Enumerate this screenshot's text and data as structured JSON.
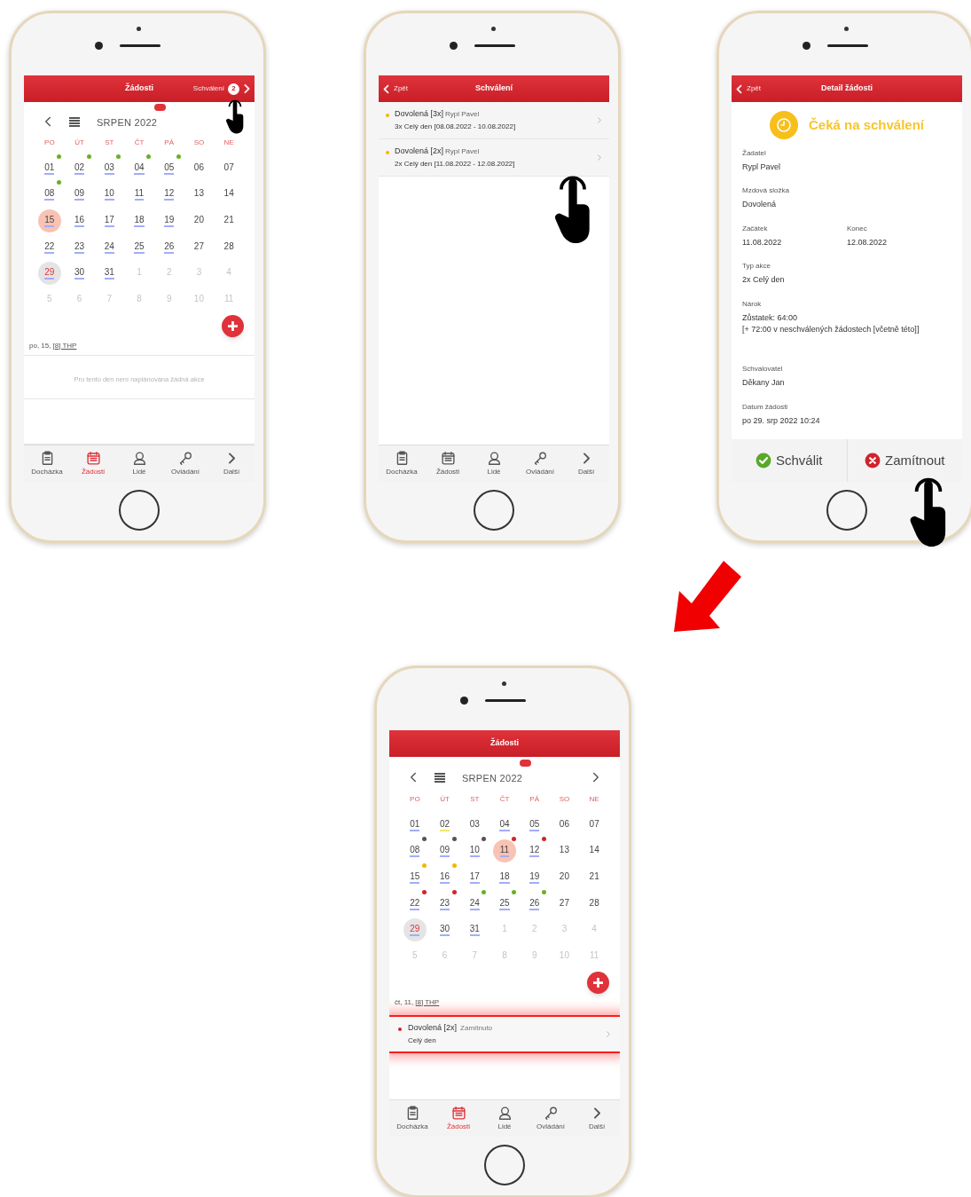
{
  "phones": [
    {
      "kind": "calendar",
      "pointer": true,
      "header": {
        "title": "Žádosti",
        "action": "Schválení",
        "badge": "2"
      },
      "calendar": {
        "month": "SRPEN 2022",
        "next_arrow": false,
        "weekdays": [
          "PO",
          "ÚT",
          "ST",
          "ČT",
          "PÁ",
          "SO",
          "NE"
        ],
        "days": [
          {
            "label": "01",
            "kind": "work",
            "selected": false,
            "today": false,
            "color": "#6ab023"
          },
          {
            "label": "02",
            "kind": "work",
            "selected": false,
            "today": false,
            "color": "#6ab023"
          },
          {
            "label": "03",
            "kind": "work",
            "selected": false,
            "today": false,
            "color": "#6ab023"
          },
          {
            "label": "04",
            "kind": "work",
            "selected": false,
            "today": false,
            "color": "#6ab023"
          },
          {
            "label": "05",
            "kind": "work",
            "selected": false,
            "today": false,
            "color": "#6ab023"
          },
          {
            "label": "06",
            "kind": "plain",
            "selected": false,
            "today": false
          },
          {
            "label": "07",
            "kind": "plain",
            "selected": false,
            "today": false
          },
          {
            "label": "08",
            "kind": "work",
            "selected": false,
            "today": false,
            "color": "#6ab023"
          },
          {
            "label": "09",
            "kind": "work",
            "selected": false,
            "today": false
          },
          {
            "label": "10",
            "kind": "work",
            "selected": false,
            "today": false
          },
          {
            "label": "11",
            "kind": "work",
            "selected": false,
            "today": false
          },
          {
            "label": "12",
            "kind": "work",
            "selected": false,
            "today": false
          },
          {
            "label": "13",
            "kind": "plain",
            "selected": false,
            "today": false
          },
          {
            "label": "14",
            "kind": "plain",
            "selected": false,
            "today": false
          },
          {
            "label": "15",
            "kind": "work",
            "selected": true,
            "today": false
          },
          {
            "label": "16",
            "kind": "work",
            "selected": false,
            "today": false
          },
          {
            "label": "17",
            "kind": "work",
            "selected": false,
            "today": false
          },
          {
            "label": "18",
            "kind": "work",
            "selected": false,
            "today": false
          },
          {
            "label": "19",
            "kind": "work",
            "selected": false,
            "today": false
          },
          {
            "label": "20",
            "kind": "plain",
            "selected": false,
            "today": false
          },
          {
            "label": "21",
            "kind": "plain",
            "selected": false,
            "today": false
          },
          {
            "label": "22",
            "kind": "work",
            "selected": false,
            "today": false
          },
          {
            "label": "23",
            "kind": "work",
            "selected": false,
            "today": false
          },
          {
            "label": "24",
            "kind": "work",
            "selected": false,
            "today": false
          },
          {
            "label": "25",
            "kind": "work",
            "selected": false,
            "today": false
          },
          {
            "label": "26",
            "kind": "work",
            "selected": false,
            "today": false
          },
          {
            "label": "27",
            "kind": "plain",
            "selected": false,
            "today": false
          },
          {
            "label": "28",
            "kind": "plain",
            "selected": false,
            "today": false
          },
          {
            "label": "29",
            "kind": "work",
            "selected": false,
            "today": true
          },
          {
            "label": "30",
            "kind": "work",
            "selected": false,
            "today": false
          },
          {
            "label": "31",
            "kind": "work",
            "selected": false,
            "today": false
          },
          {
            "label": "1",
            "kind": "outside",
            "selected": false,
            "today": false
          },
          {
            "label": "2",
            "kind": "outside",
            "selected": false,
            "today": false
          },
          {
            "label": "3",
            "kind": "outside",
            "selected": false,
            "today": false
          },
          {
            "label": "4",
            "kind": "outside",
            "selected": false,
            "today": false
          },
          {
            "label": "5",
            "kind": "outside",
            "selected": false,
            "today": false
          },
          {
            "label": "6",
            "kind": "outside",
            "selected": false,
            "today": false
          },
          {
            "label": "7",
            "kind": "outside",
            "selected": false,
            "today": false
          },
          {
            "label": "8",
            "kind": "outside",
            "selected": false,
            "today": false
          },
          {
            "label": "9",
            "kind": "outside",
            "selected": false,
            "today": false
          },
          {
            "label": "10",
            "kind": "outside",
            "selected": false,
            "today": false
          },
          {
            "label": "11",
            "kind": "outside",
            "selected": false,
            "today": false
          }
        ]
      },
      "day_label": {
        "date": "po, 15,",
        "shift": "[8] THP"
      },
      "empty_message": "Pro tento den není naplánována žádná akce",
      "tabs": [
        {
          "label": "Docházka",
          "kind": "clipboard",
          "selected": false
        },
        {
          "label": "Žádosti",
          "kind": "calendar",
          "selected": true
        },
        {
          "label": "Lidé",
          "kind": "person",
          "selected": false
        },
        {
          "label": "Ovládání",
          "kind": "key",
          "selected": false
        },
        {
          "label": "Další",
          "kind": "more",
          "selected": false
        }
      ]
    },
    {
      "kind": "list",
      "pointer": true,
      "header": {
        "back": "Zpět",
        "title": "Schválení"
      },
      "items": [
        {
          "title": "Dovolená [3x]",
          "person": "Rypl Pavel",
          "subtitle": "3x Celý den [08.08.2022 - 10.08.2022]",
          "color": "#f5b800"
        },
        {
          "title": "Dovolená [2x]",
          "person": "Rypl Pavel",
          "subtitle": "2x Celý den [11.08.2022 - 12.08.2022]",
          "color": "#f5b800"
        }
      ],
      "tabs": [
        {
          "label": "Docházka",
          "kind": "clipboard",
          "selected": false
        },
        {
          "label": "Žádosti",
          "kind": "calendar",
          "selected": false
        },
        {
          "label": "Lidé",
          "kind": "person",
          "selected": false
        },
        {
          "label": "Ovládání",
          "kind": "key",
          "selected": false
        },
        {
          "label": "Další",
          "kind": "more",
          "selected": false
        }
      ]
    },
    {
      "kind": "detail",
      "pointer": true,
      "header": {
        "back": "Zpět",
        "title": "Detail žádosti"
      },
      "status": "Čeká na schválení",
      "fields": [
        {
          "label": "Žadatel",
          "value": "Rypl Pavel",
          "kind": "full"
        },
        {
          "label": "Mzdová složka",
          "value": "Dovolená",
          "kind": "full"
        },
        {
          "label": "Začátek",
          "value": "11.08.2022",
          "kind": "half"
        },
        {
          "label": "Konec",
          "value": "12.08.2022",
          "kind": "half"
        },
        {
          "label": "Typ akce",
          "value": "2x Celý den",
          "kind": "full"
        },
        {
          "label": "Nárok",
          "value": "Zůstatek: 64:00\n[+ 72:00 v neschválených žádostech [včetně této]]",
          "kind": "tall"
        },
        {
          "label": "Schvalovatel",
          "value": "Děkany Jan",
          "kind": "full"
        },
        {
          "label": "Datum žádosti",
          "value": "po 29. srp 2022 10:24",
          "kind": "full"
        }
      ],
      "actions": [
        {
          "label": "Schválit",
          "kind": "approve"
        },
        {
          "label": "Zamítnout",
          "kind": "reject"
        }
      ]
    },
    {
      "kind": "calendar",
      "pointer": false,
      "header": {
        "title": "Žádosti"
      },
      "calendar": {
        "month": "SRPEN 2022",
        "next_arrow": true,
        "weekdays": [
          "PO",
          "ÚT",
          "ST",
          "ČT",
          "PÁ",
          "SO",
          "NE"
        ],
        "days": [
          {
            "label": "01",
            "kind": "work",
            "selected": false,
            "today": false
          },
          {
            "label": "02",
            "kind": "pending",
            "selected": false,
            "today": false
          },
          {
            "label": "03",
            "kind": "plain",
            "selected": false,
            "today": false
          },
          {
            "label": "04",
            "kind": "work",
            "selected": false,
            "today": false
          },
          {
            "label": "05",
            "kind": "work",
            "selected": false,
            "today": false
          },
          {
            "label": "06",
            "kind": "plain",
            "selected": false,
            "today": false
          },
          {
            "label": "07",
            "kind": "plain",
            "selected": false,
            "today": false
          },
          {
            "label": "08",
            "kind": "work",
            "selected": false,
            "today": false,
            "color": "#555555"
          },
          {
            "label": "09",
            "kind": "work",
            "selected": false,
            "today": false,
            "color": "#555555"
          },
          {
            "label": "10",
            "kind": "work",
            "selected": false,
            "today": false,
            "color": "#555555"
          },
          {
            "label": "11",
            "kind": "work",
            "selected": true,
            "today": false,
            "color": "#d2232a"
          },
          {
            "label": "12",
            "kind": "work",
            "selected": false,
            "today": false,
            "color": "#d2232a"
          },
          {
            "label": "13",
            "kind": "plain",
            "selected": false,
            "today": false
          },
          {
            "label": "14",
            "kind": "plain",
            "selected": false,
            "today": false
          },
          {
            "label": "15",
            "kind": "work",
            "selected": false,
            "today": false,
            "color": "#f5b800"
          },
          {
            "label": "16",
            "kind": "work",
            "selected": false,
            "today": false,
            "color": "#f5b800"
          },
          {
            "label": "17",
            "kind": "work",
            "selected": false,
            "today": false
          },
          {
            "label": "18",
            "kind": "work",
            "selected": false,
            "today": false
          },
          {
            "label": "19",
            "kind": "work",
            "selected": false,
            "today": false
          },
          {
            "label": "20",
            "kind": "plain",
            "selected": false,
            "today": false
          },
          {
            "label": "21",
            "kind": "plain",
            "selected": false,
            "today": false
          },
          {
            "label": "22",
            "kind": "work",
            "selected": false,
            "today": false,
            "color": "#d2232a"
          },
          {
            "label": "23",
            "kind": "work",
            "selected": false,
            "today": false,
            "color": "#d2232a"
          },
          {
            "label": "24",
            "kind": "work",
            "selected": false,
            "today": false,
            "color": "#6ab023"
          },
          {
            "label": "25",
            "kind": "work",
            "selected": false,
            "today": false,
            "color": "#6ab023"
          },
          {
            "label": "26",
            "kind": "work",
            "selected": false,
            "today": false,
            "color": "#6ab023"
          },
          {
            "label": "27",
            "kind": "plain",
            "selected": false,
            "today": false
          },
          {
            "label": "28",
            "kind": "plain",
            "selected": false,
            "today": false
          },
          {
            "label": "29",
            "kind": "work",
            "selected": false,
            "today": true
          },
          {
            "label": "30",
            "kind": "work",
            "selected": false,
            "today": false
          },
          {
            "label": "31",
            "kind": "work",
            "selected": false,
            "today": false
          },
          {
            "label": "1",
            "kind": "outside",
            "selected": false,
            "today": false
          },
          {
            "label": "2",
            "kind": "outside",
            "selected": false,
            "today": false
          },
          {
            "label": "3",
            "kind": "outside",
            "selected": false,
            "today": false
          },
          {
            "label": "4",
            "kind": "outside",
            "selected": false,
            "today": false
          },
          {
            "label": "5",
            "kind": "outside",
            "selected": false,
            "today": false
          },
          {
            "label": "6",
            "kind": "outside",
            "selected": false,
            "today": false
          },
          {
            "label": "7",
            "kind": "outside",
            "selected": false,
            "today": false
          },
          {
            "label": "8",
            "kind": "outside",
            "selected": false,
            "today": false
          },
          {
            "label": "9",
            "kind": "outside",
            "selected": false,
            "today": false
          },
          {
            "label": "10",
            "kind": "outside",
            "selected": false,
            "today": false
          },
          {
            "label": "11",
            "kind": "outside",
            "selected": false,
            "today": false
          }
        ]
      },
      "day_label": {
        "date": "čt, 11,",
        "shift": "[8] THP"
      },
      "events": [
        {
          "title": "Dovolená [2x]",
          "status": "Zamítnuto",
          "subtitle": "Celý den",
          "color": "#d2232a",
          "highlighted": true
        }
      ],
      "tabs": [
        {
          "label": "Docházka",
          "kind": "clipboard",
          "selected": false
        },
        {
          "label": "Žádosti",
          "kind": "calendar",
          "selected": true
        },
        {
          "label": "Lidé",
          "kind": "person",
          "selected": false
        },
        {
          "label": "Ovládání",
          "kind": "key",
          "selected": false
        },
        {
          "label": "Další",
          "kind": "more",
          "selected": false
        }
      ]
    }
  ]
}
